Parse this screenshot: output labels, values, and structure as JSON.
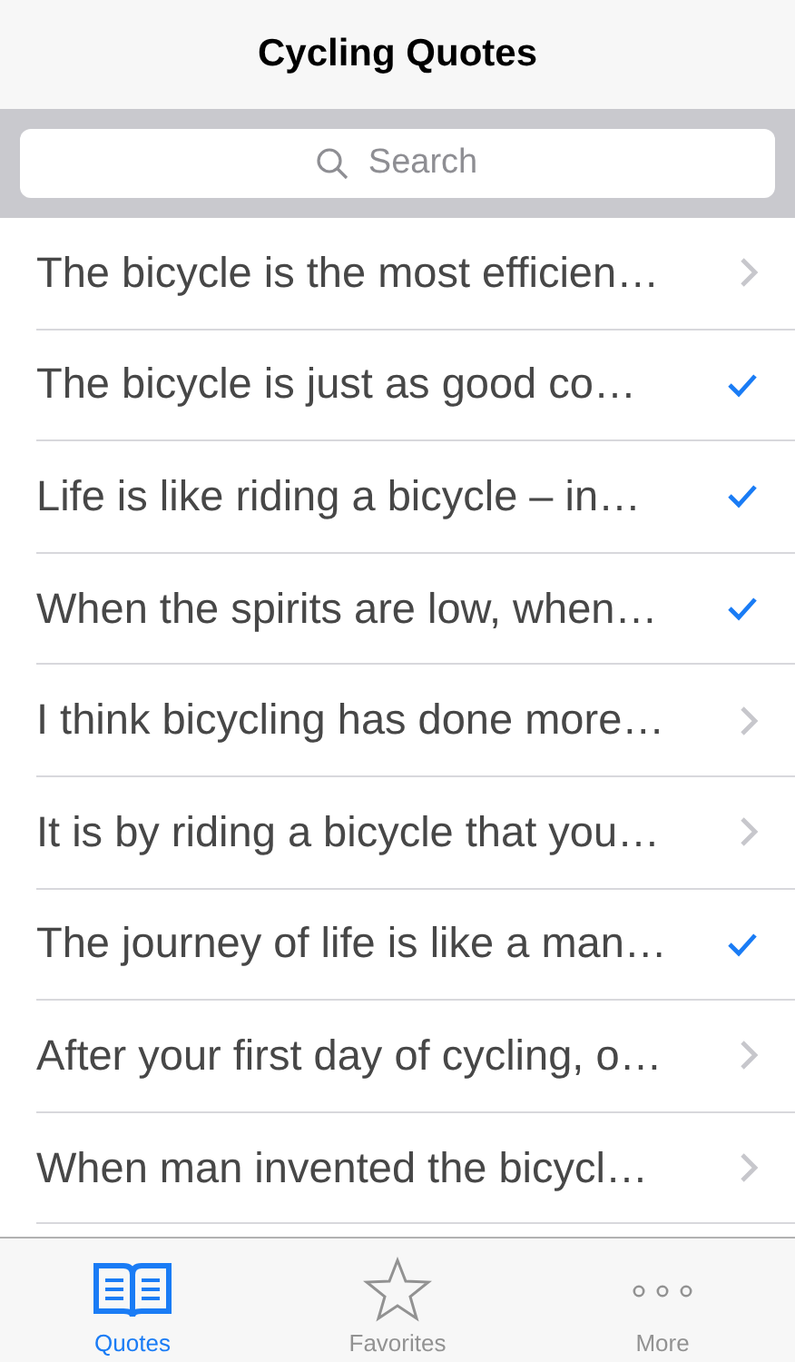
{
  "nav_bar": {
    "title": "Cycling Quotes"
  },
  "search": {
    "placeholder": "Search"
  },
  "quotes": [
    {
      "text": "The bicycle is the most efficien…",
      "favorite": false
    },
    {
      "text": "The bicycle is just as good co…",
      "favorite": true
    },
    {
      "text": "Life is like riding a bicycle – in…",
      "favorite": true
    },
    {
      "text": "When the spirits are low, when…",
      "favorite": true
    },
    {
      "text": "I think bicycling has done more…",
      "favorite": false
    },
    {
      "text": "It is by riding a bicycle that you…",
      "favorite": false
    },
    {
      "text": "The journey of life is like a man…",
      "favorite": true
    },
    {
      "text": "After your first day of cycling, o…",
      "favorite": false
    },
    {
      "text": "When man invented the bicycl…",
      "favorite": false
    }
  ],
  "tab_bar": [
    {
      "label": "Quotes",
      "kind": "book",
      "selected": true
    },
    {
      "label": "Favorites",
      "kind": "star",
      "selected": false
    },
    {
      "label": "More",
      "kind": "more",
      "selected": false
    }
  ]
}
